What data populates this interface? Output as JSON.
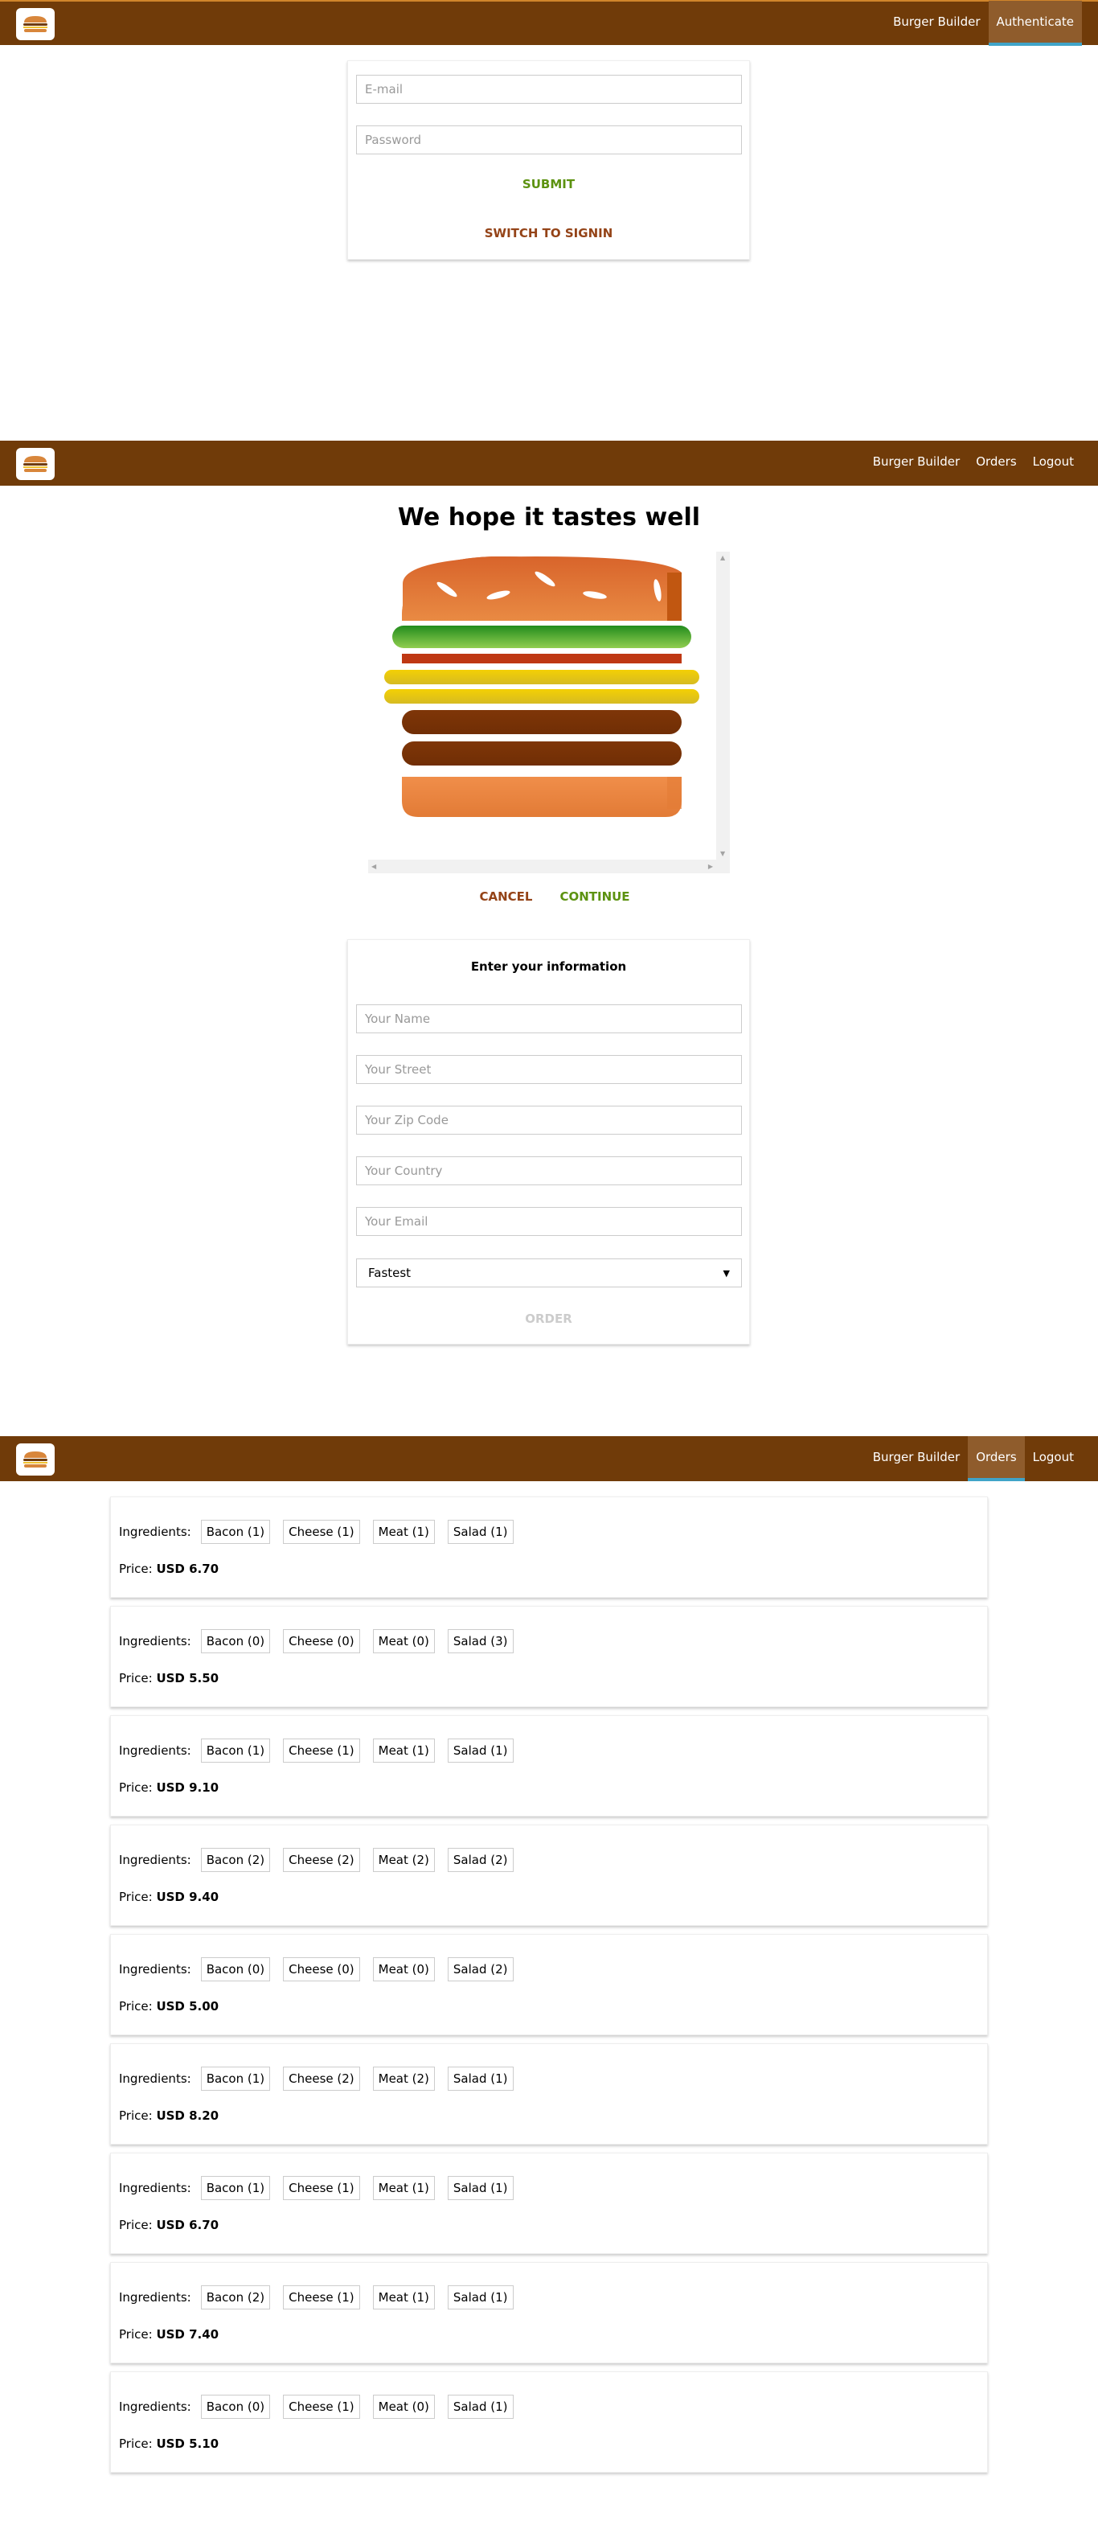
{
  "auth": {
    "nav": [
      "Burger Builder",
      "Authenticate"
    ],
    "email_placeholder": "E-mail",
    "password_placeholder": "Password",
    "submit": "SUBMIT",
    "switch": "SWITCH TO SIGNIN"
  },
  "checkout": {
    "nav": [
      "Burger Builder",
      "Orders",
      "Logout"
    ],
    "title": "We hope it tastes well",
    "cancel": "CANCEL",
    "continue": "CONTINUE",
    "form_title": "Enter your information",
    "fields": [
      "Your Name",
      "Your Street",
      "Your Zip Code",
      "Your Country",
      "Your Email"
    ],
    "delivery": "Fastest",
    "order": "ORDER"
  },
  "orders": {
    "nav": [
      "Burger Builder",
      "Orders",
      "Logout"
    ],
    "ingredients_label": "Ingredients:",
    "price_label": "Price:",
    "list": [
      {
        "ingredients": [
          "Bacon (1)",
          "Cheese (1)",
          "Meat (1)",
          "Salad (1)"
        ],
        "price": "USD 6.70"
      },
      {
        "ingredients": [
          "Bacon (0)",
          "Cheese (0)",
          "Meat (0)",
          "Salad (3)"
        ],
        "price": "USD 5.50"
      },
      {
        "ingredients": [
          "Bacon (1)",
          "Cheese (1)",
          "Meat (1)",
          "Salad (1)"
        ],
        "price": "USD 9.10"
      },
      {
        "ingredients": [
          "Bacon (2)",
          "Cheese (2)",
          "Meat (2)",
          "Salad (2)"
        ],
        "price": "USD 9.40"
      },
      {
        "ingredients": [
          "Bacon (0)",
          "Cheese (0)",
          "Meat (0)",
          "Salad (2)"
        ],
        "price": "USD 5.00"
      },
      {
        "ingredients": [
          "Bacon (1)",
          "Cheese (2)",
          "Meat (2)",
          "Salad (1)"
        ],
        "price": "USD 8.20"
      },
      {
        "ingredients": [
          "Bacon (1)",
          "Cheese (1)",
          "Meat (1)",
          "Salad (1)"
        ],
        "price": "USD 6.70"
      },
      {
        "ingredients": [
          "Bacon (2)",
          "Cheese (1)",
          "Meat (1)",
          "Salad (1)"
        ],
        "price": "USD 7.40"
      },
      {
        "ingredients": [
          "Bacon (0)",
          "Cheese (1)",
          "Meat (0)",
          "Salad (1)"
        ],
        "price": "USD 5.10"
      }
    ]
  },
  "colors": {
    "toolbar": "#703b09",
    "success": "#5c9210",
    "danger": "#944317",
    "active_nav": "#8f5c2c"
  }
}
